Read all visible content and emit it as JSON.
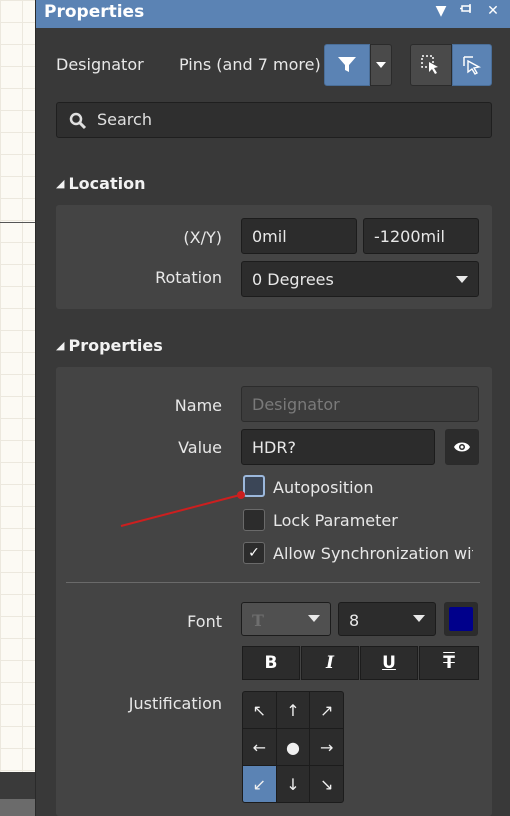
{
  "panel": {
    "title": "Properties",
    "title_icons": [
      "dropdown-icon",
      "pin-icon",
      "close-icon"
    ]
  },
  "filter": {
    "object_type": "Designator",
    "selection": "Pins (and 7 more)"
  },
  "search": {
    "placeholder": "Search"
  },
  "location": {
    "title": "Location",
    "xy_label": "(X/Y)",
    "x_value": "0mil",
    "y_value": "-1200mil",
    "rotation_label": "Rotation",
    "rotation_value": "0 Degrees"
  },
  "properties": {
    "title": "Properties",
    "name_label": "Name",
    "name_placeholder": "Designator",
    "value_label": "Value",
    "value_value": "HDR?",
    "checkboxes": [
      {
        "label": "Autoposition",
        "checked": false
      },
      {
        "label": "Lock Parameter",
        "checked": false
      },
      {
        "label": "Allow Synchronization wit",
        "checked": true
      }
    ],
    "font_label": "Font",
    "font_size": "8",
    "font_color": "#00008b",
    "format_buttons": [
      "B",
      "I",
      "U",
      "T"
    ],
    "justification_label": "Justification",
    "justification_arrows": [
      "↖",
      "↑",
      "↗",
      "←",
      "●",
      "→",
      "↙",
      "↓",
      "↘"
    ],
    "justification_selected": "bottom-left"
  },
  "colors": {
    "accent": "#5b83b4",
    "panel_bg": "#393939",
    "card_bg": "#444444",
    "annotation": "#cc1f1f"
  }
}
